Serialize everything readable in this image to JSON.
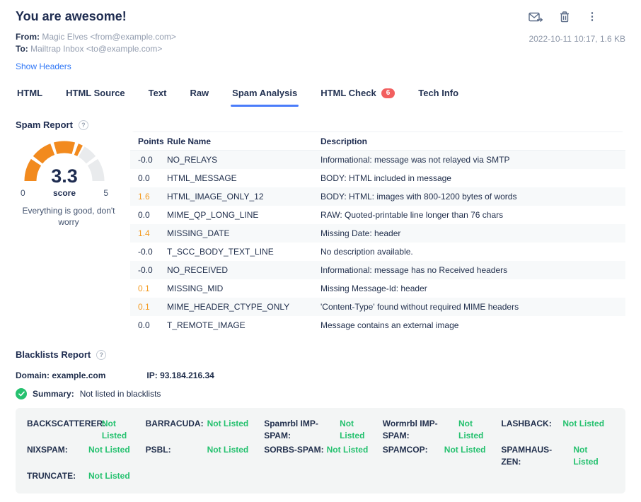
{
  "header": {
    "title": "You are awesome!",
    "from_label": "From:",
    "from_value": "Magic Elves <from@example.com>",
    "to_label": "To:",
    "to_value": "Mailtrap Inbox <to@example.com>",
    "show_headers": "Show Headers",
    "meta": "2022-10-11 10:17, 1.6 KB",
    "icons": [
      "forward-email-icon",
      "trash-icon",
      "more-options-icon"
    ]
  },
  "tabs": [
    {
      "label": "HTML",
      "active": false
    },
    {
      "label": "HTML Source",
      "active": false
    },
    {
      "label": "Text",
      "active": false
    },
    {
      "label": "Raw",
      "active": false
    },
    {
      "label": "Spam Analysis",
      "active": true
    },
    {
      "label": "HTML Check",
      "active": false,
      "badge": "6"
    },
    {
      "label": "Tech Info",
      "active": false
    }
  ],
  "spam_report": {
    "heading": "Spam Report",
    "chart_data": {
      "type": "gauge",
      "score": 3.3,
      "min": 0,
      "max": 5,
      "segments": 5,
      "min_label": "0",
      "max_label": "5",
      "score_label": "score",
      "message": "Everything is good, don't worry",
      "filled_color": "#f28a1e",
      "empty_color": "#e9ebed"
    },
    "table": {
      "columns": [
        "Points",
        "Rule Name",
        "Description"
      ],
      "rows": [
        {
          "points": "-0.0",
          "rule": "NO_RELAYS",
          "description": "Informational: message was not relayed via SMTP",
          "highlight": false
        },
        {
          "points": "0.0",
          "rule": "HTML_MESSAGE",
          "description": "BODY: HTML included in message",
          "highlight": false
        },
        {
          "points": "1.6",
          "rule": "HTML_IMAGE_ONLY_12",
          "description": "BODY: HTML: images with 800-1200 bytes of words",
          "highlight": true
        },
        {
          "points": "0.0",
          "rule": "MIME_QP_LONG_LINE",
          "description": "RAW: Quoted-printable line longer than 76 chars",
          "highlight": false
        },
        {
          "points": "1.4",
          "rule": "MISSING_DATE",
          "description": "Missing Date: header",
          "highlight": true
        },
        {
          "points": "-0.0",
          "rule": "T_SCC_BODY_TEXT_LINE",
          "description": "No description available.",
          "highlight": false
        },
        {
          "points": "-0.0",
          "rule": "NO_RECEIVED",
          "description": "Informational: message has no Received headers",
          "highlight": false
        },
        {
          "points": "0.1",
          "rule": "MISSING_MID",
          "description": "Missing Message-Id: header",
          "highlight": true
        },
        {
          "points": "0.1",
          "rule": "MIME_HEADER_CTYPE_ONLY",
          "description": "'Content-Type' found without required MIME headers",
          "highlight": true
        },
        {
          "points": "0.0",
          "rule": "T_REMOTE_IMAGE",
          "description": "Message contains an external image",
          "highlight": false
        }
      ]
    }
  },
  "blacklists_report": {
    "heading": "Blacklists Report",
    "domain_label": "Domain:",
    "domain": "example.com",
    "ip_label": "IP:",
    "ip": "93.184.216.34",
    "summary_label": "Summary:",
    "summary": "Not listed in blacklists",
    "entries": [
      {
        "name": "BACKSCATTERER:",
        "status": "Not Listed"
      },
      {
        "name": "BARRACUDA:",
        "status": "Not Listed"
      },
      {
        "name": "Spamrbl IMP-SPAM:",
        "status": "Not Listed"
      },
      {
        "name": "Wormrbl IMP-SPAM:",
        "status": "Not Listed"
      },
      {
        "name": "LASHBACK:",
        "status": "Not Listed"
      },
      {
        "name": "NIXSPAM:",
        "status": "Not Listed"
      },
      {
        "name": "PSBL:",
        "status": "Not Listed"
      },
      {
        "name": "SORBS-SPAM:",
        "status": "Not Listed"
      },
      {
        "name": "SPAMCOP:",
        "status": "Not Listed"
      },
      {
        "name": "SPAMHAUS-ZEN:",
        "status": "Not Listed"
      },
      {
        "name": "TRUNCATE:",
        "status": "Not Listed"
      }
    ]
  },
  "colors": {
    "accent_blue": "#4a7cfa",
    "link_blue": "#3077f6",
    "orange": "#f28a1e",
    "green": "#25c16f",
    "badge_red": "#f25f5f",
    "navy": "#1e2c50"
  }
}
